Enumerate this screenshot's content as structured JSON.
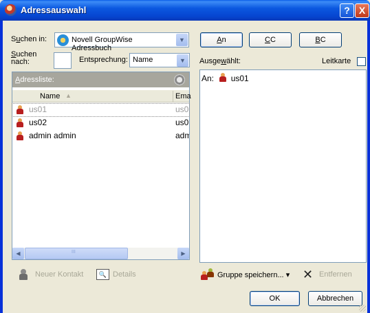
{
  "window": {
    "title": "Adressauswahl",
    "help": "?",
    "close": "X"
  },
  "search_in": {
    "label_pre": "S",
    "label_ul": "u",
    "label_post": "chen in:",
    "value": "Novell GroupWise Adressbuch"
  },
  "search_for": {
    "label_line1_ul": "S",
    "label_line1_post": "uchen",
    "label_line2": "nach:",
    "value": ""
  },
  "match": {
    "label": "Entsprechung:",
    "value": "Name"
  },
  "address_list": {
    "header_pre": "",
    "header_ul": "A",
    "header_post": "dressliste:",
    "columns": {
      "name": "Name",
      "sort": "▲",
      "email": "Ema"
    },
    "rows": [
      {
        "name": "us01",
        "email": "us0"
      },
      {
        "name": "us02",
        "email": "us0"
      },
      {
        "name": "admin admin",
        "email": "adm"
      }
    ],
    "scroll": {
      "left": "◀",
      "right": "▶",
      "grip": "III"
    }
  },
  "bottom_left": {
    "new_contact": "Neuer Kontakt",
    "details": "Details",
    "details_icon_glyph": "🔍"
  },
  "recipient_buttons": {
    "to_ul": "A",
    "to_post": "n",
    "cc_ul": "C",
    "cc_post": "C",
    "bc_ul": "B",
    "bc_post": "C"
  },
  "selected": {
    "label_pre": "Ausge",
    "label_ul": "w",
    "label_post": "ählt:",
    "leitkarte": "Leitkarte",
    "entry_prefix": "An:",
    "entry_name": "us01"
  },
  "bottom_right": {
    "save_group": "Gruppe speichern...",
    "dropdown": "▾",
    "remove": "Entfernen"
  },
  "footer": {
    "ok": "OK",
    "cancel": "Abbrechen"
  },
  "colors": {
    "titlebar": "#0b58e0",
    "face": "#ece9d8",
    "list_header": "#a7a69d",
    "person": "#b81f1f"
  }
}
